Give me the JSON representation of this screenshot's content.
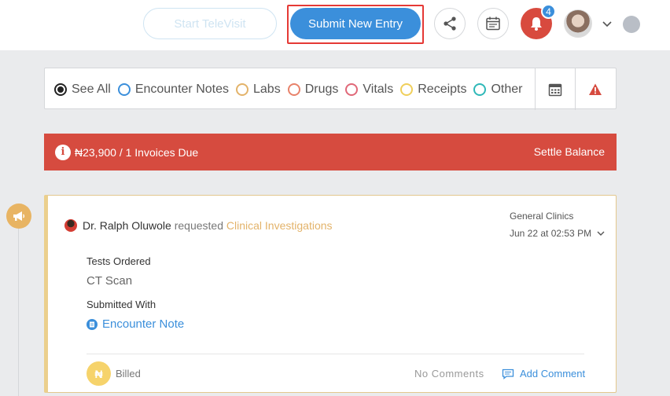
{
  "header": {
    "televisit_label": "Start TeleVisit",
    "submit_label": "Submit New Entry",
    "notification_count": "4"
  },
  "filters": [
    {
      "label": "See All",
      "color": "#222222",
      "checked": true
    },
    {
      "label": "Encounter Notes",
      "color": "#3b8fdb",
      "checked": false
    },
    {
      "label": "Labs",
      "color": "#e3b36a",
      "checked": false
    },
    {
      "label": "Drugs",
      "color": "#e8826a",
      "checked": false
    },
    {
      "label": "Vitals",
      "color": "#e06878",
      "checked": false
    },
    {
      "label": "Receipts",
      "color": "#f0cf5a",
      "checked": false
    },
    {
      "label": "Other",
      "color": "#2fb8b8",
      "checked": false
    }
  ],
  "balance": {
    "text": "₦23,900 / 1 Invoices Due",
    "action": "Settle Balance"
  },
  "entry": {
    "doctor": "Dr. Ralph Oluwole",
    "verb": "requested",
    "type": "Clinical Investigations",
    "clinic": "General Clinics",
    "date": "Jun 22 at 02:53 PM",
    "tests_label": "Tests Ordered",
    "test": "CT Scan",
    "submitted_label": "Submitted With",
    "submitted_item": "Encounter Note",
    "billing_symbol": "₦",
    "billing_status": "Billed",
    "comments": "No Comments",
    "add_comment": "Add Comment"
  },
  "colors": {
    "primary": "#3b8fdb",
    "danger": "#d64b3f",
    "accent": "#e8b463"
  }
}
